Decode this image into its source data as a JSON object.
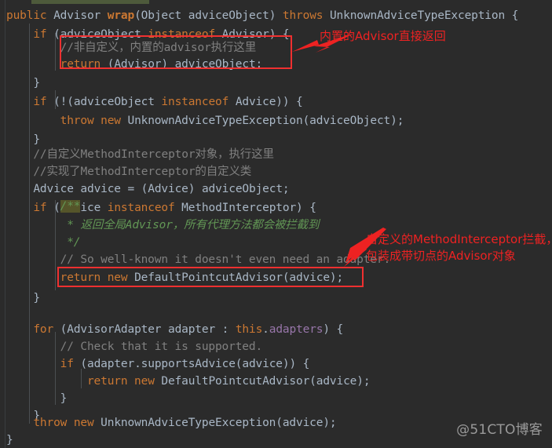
{
  "editor": {
    "background_color": "#2b2b2b",
    "default_text_color": "#a9b7c6",
    "keyword_color": "#cc7832",
    "comment_color": "#808080",
    "javadoc_color": "#629755",
    "field_color": "#9876aa",
    "annotation_color": "#ee2222"
  },
  "code_lines": [
    {
      "indent": 0,
      "text": "public Advisor wrap(Object adviceObject) throws UnknownAdviceTypeException {"
    },
    {
      "indent": 1,
      "text": "if (adviceObject instanceof Advisor) {"
    },
    {
      "indent": 2,
      "text": "//非自定义，内置的advisor执行这里"
    },
    {
      "indent": 2,
      "text": "return (Advisor) adviceObject;"
    },
    {
      "indent": 1,
      "text": "}"
    },
    {
      "indent": 1,
      "text": "if (!(adviceObject instanceof Advice)) {"
    },
    {
      "indent": 2,
      "text": "throw new UnknownAdviceTypeException(adviceObject);"
    },
    {
      "indent": 1,
      "text": "}"
    },
    {
      "indent": 1,
      "text": "//自定义MethodInterceptor对象，执行这里"
    },
    {
      "indent": 1,
      "text": "//实现了MethodInterceptor的自定义类"
    },
    {
      "indent": 1,
      "text": "Advice advice = (Advice) adviceObject;"
    },
    {
      "indent": 1,
      "text": "if (advice instanceof MethodInterceptor) {"
    },
    {
      "indent": 2,
      "text": "/**"
    },
    {
      "indent": 2,
      "text": " * 返回全局Advisor，所有代理方法都会被拦截到"
    },
    {
      "indent": 2,
      "text": " */"
    },
    {
      "indent": 2,
      "text": "// So well-known it doesn't even need an adapter."
    },
    {
      "indent": 2,
      "text": "return new DefaultPointcutAdvisor(advice);"
    },
    {
      "indent": 1,
      "text": "}"
    },
    {
      "indent": 0,
      "text": ""
    },
    {
      "indent": 1,
      "text": "for (AdvisorAdapter adapter : this.adapters) {"
    },
    {
      "indent": 2,
      "text": "// Check that it is supported."
    },
    {
      "indent": 2,
      "text": "if (adapter.supportsAdvice(advice)) {"
    },
    {
      "indent": 3,
      "text": "return new DefaultPointcutAdvisor(advice);"
    },
    {
      "indent": 2,
      "text": "}"
    },
    {
      "indent": 1,
      "text": "}"
    },
    {
      "indent": 1,
      "text": "throw new UnknownAdviceTypeException(advice);"
    },
    {
      "indent": 0,
      "text": "}"
    }
  ],
  "annotations": [
    {
      "id": "annotation-builtin-advisor",
      "text": "内置的Advisor直接返回",
      "color": "#ee2222"
    },
    {
      "id": "annotation-custom-interceptor",
      "text": "自定义的MethodInterceptor拦截，包装成带切点的Advisor对象",
      "color": "#ee2222"
    }
  ],
  "highlight_boxes": [
    {
      "id": "highlight-box-return-advisor",
      "label": "return (Advisor) adviceObject;"
    },
    {
      "id": "highlight-box-default-pointcut-advisor",
      "label": "return new DefaultPointcutAdvisor(advice);"
    }
  ],
  "watermark": {
    "text": "@51CTO博客"
  }
}
